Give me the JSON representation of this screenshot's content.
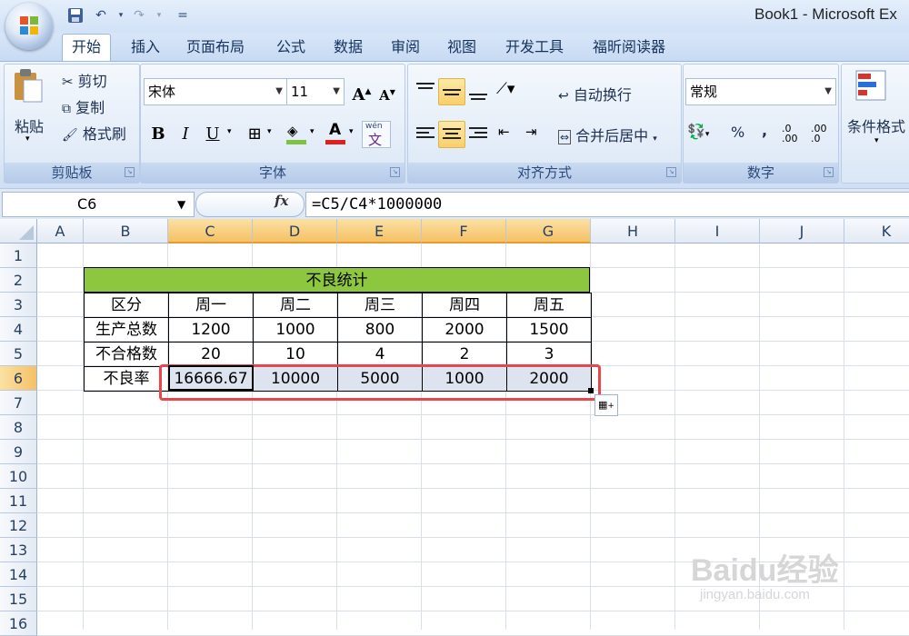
{
  "window": {
    "title": "Book1 - Microsoft Ex"
  },
  "qat": {
    "save_icon": "save-icon",
    "undo_icon": "undo-icon",
    "redo_icon": "redo-icon",
    "customize": "="
  },
  "tabs": [
    "开始",
    "插入",
    "页面布局",
    "公式",
    "数据",
    "审阅",
    "视图",
    "开发工具",
    "福昕阅读器"
  ],
  "ribbon": {
    "clipboard": {
      "paste": "粘贴",
      "cut": "剪切",
      "copy": "复制",
      "format_painter": "格式刷",
      "label": "剪贴板"
    },
    "font": {
      "name": "宋体",
      "size": "11",
      "bold": "B",
      "italic": "I",
      "underline": "U",
      "grow": "A",
      "shrink": "A",
      "font_color": "A",
      "phonetic": "wén",
      "label": "字体"
    },
    "alignment": {
      "wrap": "自动换行",
      "merge": "合并后居中",
      "label": "对齐方式"
    },
    "number": {
      "format": "常规",
      "percent": "%",
      "comma": ",",
      "inc_decimal": ".0 .00",
      "dec_decimal": ".00 .0",
      "label": "数字"
    },
    "styles": {
      "conditional": "条件格式"
    }
  },
  "formula_bar": {
    "name_box": "C6",
    "fx": "fx",
    "formula": "=C5/C4*1000000"
  },
  "columns": [
    "A",
    "B",
    "C",
    "D",
    "E",
    "F",
    "G",
    "H",
    "I",
    "J",
    "K"
  ],
  "rows": [
    "1",
    "2",
    "3",
    "4",
    "5",
    "6",
    "7",
    "8",
    "9",
    "10",
    "11",
    "12",
    "13",
    "14",
    "15",
    "16"
  ],
  "table": {
    "title": "不良统计",
    "header": [
      "区分",
      "周一",
      "周二",
      "周三",
      "周四",
      "周五"
    ],
    "rows": [
      [
        "生产总数",
        "1200",
        "1000",
        "800",
        "2000",
        "1500"
      ],
      [
        "不合格数",
        "20",
        "10",
        "4",
        "2",
        "3"
      ],
      [
        "不良率",
        "16666.67",
        "10000",
        "5000",
        "1000",
        "2000"
      ]
    ]
  },
  "colors": {
    "title_fill": "#8dc63f",
    "highlight_box": "#e8454d",
    "selected_header": "#f5c165"
  },
  "watermark": {
    "text": "Baidu经验",
    "sub": "jingyan.baidu.com"
  }
}
